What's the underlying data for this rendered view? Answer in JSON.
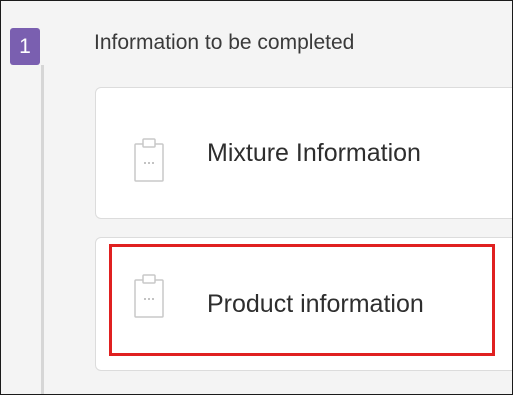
{
  "step": {
    "number": "1",
    "title": "Information to be completed"
  },
  "cards": [
    {
      "label": "Mixture Information",
      "icon": "clipboard-icon"
    },
    {
      "label": "Product information",
      "icon": "clipboard-icon"
    }
  ],
  "colors": {
    "badge": "#7a5fb0",
    "highlight": "#e02020",
    "background": "#f4f4f4",
    "card": "#ffffff"
  }
}
